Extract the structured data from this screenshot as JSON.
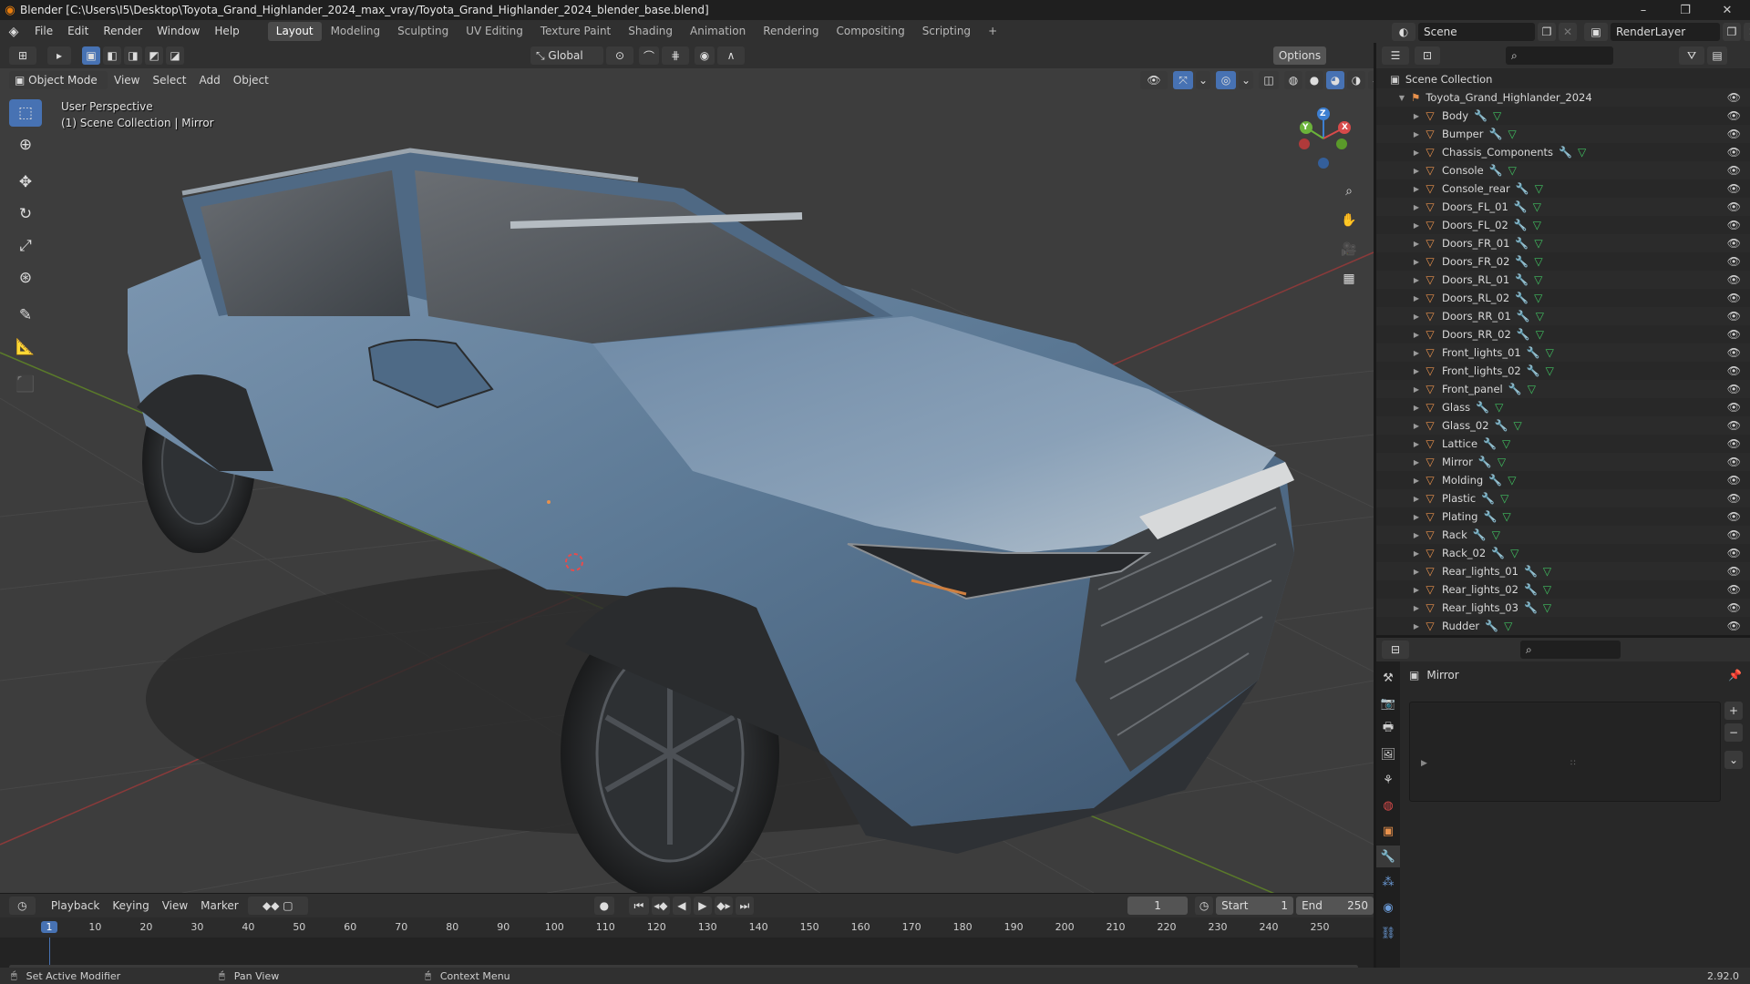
{
  "window": {
    "title": "Blender [C:\\Users\\I5\\Desktop\\Toyota_Grand_Highlander_2024_max_vray/Toyota_Grand_Highlander_2024_blender_base.blend]",
    "minimize": "–",
    "maximize": "❐",
    "close": "✕"
  },
  "menu": [
    "File",
    "Edit",
    "Render",
    "Window",
    "Help"
  ],
  "workspaces": [
    "Layout",
    "Modeling",
    "Sculpting",
    "UV Editing",
    "Texture Paint",
    "Shading",
    "Animation",
    "Rendering",
    "Compositing",
    "Scripting"
  ],
  "workspace_add": "+",
  "scene": {
    "label": "Scene",
    "render_layer": "RenderLayer"
  },
  "viewport": {
    "mode": "Object Mode",
    "menus": [
      "View",
      "Select",
      "Add",
      "Object"
    ],
    "transform_orientation": "Global",
    "options": "Options",
    "perspective": "User Perspective",
    "collection_info": "(1) Scene Collection | Mirror",
    "axis_labels": {
      "x": "X",
      "y": "Y",
      "z": "Z"
    }
  },
  "outliner": {
    "root": "Scene Collection",
    "collection": "Toyota_Grand_Highlander_2024",
    "objects": [
      "Body",
      "Bumper",
      "Chassis_Components",
      "Console",
      "Console_rear",
      "Doors_FL_01",
      "Doors_FL_02",
      "Doors_FR_01",
      "Doors_FR_02",
      "Doors_RL_01",
      "Doors_RL_02",
      "Doors_RR_01",
      "Doors_RR_02",
      "Front_lights_01",
      "Front_lights_02",
      "Front_panel",
      "Glass",
      "Glass_02",
      "Lattice",
      "Mirror",
      "Molding",
      "Plastic",
      "Plating",
      "Rack",
      "Rack_02",
      "Rear_lights_01",
      "Rear_lights_02",
      "Rear_lights_03",
      "Rudder"
    ]
  },
  "properties": {
    "object_name": "Mirror"
  },
  "timeline": {
    "menus": [
      "Playback",
      "Keying",
      "View",
      "Marker"
    ],
    "current_frame": "1",
    "start_label": "Start",
    "start": "1",
    "end_label": "End",
    "end": "250",
    "ticks": [
      "1",
      "10",
      "20",
      "30",
      "40",
      "50",
      "60",
      "70",
      "80",
      "90",
      "100",
      "110",
      "120",
      "130",
      "140",
      "150",
      "160",
      "170",
      "180",
      "190",
      "200",
      "210",
      "220",
      "230",
      "240",
      "250"
    ]
  },
  "status": {
    "left": "Set Active Modifier",
    "middle": "Pan View",
    "right": "Context Menu",
    "version": "2.92.0"
  },
  "colors": {
    "accent": "#4772b3",
    "mesh_icon": "#e8914c",
    "modifier_icon": "#6b9bd8",
    "data_icon": "#40c060",
    "car_body": "#5b7894"
  }
}
